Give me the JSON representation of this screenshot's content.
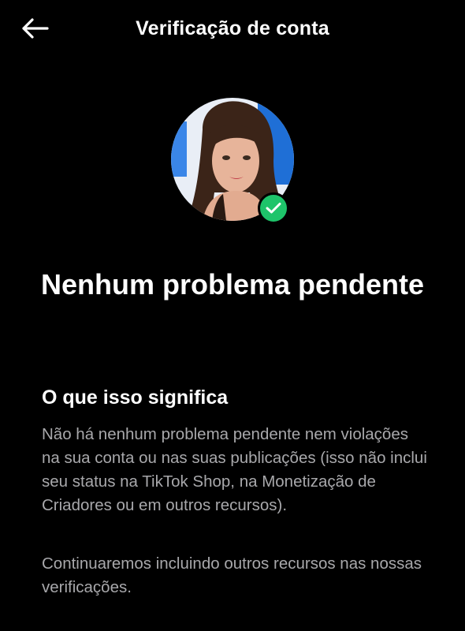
{
  "header": {
    "title": "Verificação de conta",
    "back_icon": "arrow-left-icon"
  },
  "profile": {
    "avatar": "profile-photo",
    "badge_icon": "check-icon",
    "badge_color": "#1ec46a"
  },
  "status": {
    "headline": "Nenhum problema pendente"
  },
  "info": {
    "title": "O que isso significa",
    "paragraph_1": "Não há nenhum problema pendente nem violações na sua conta ou nas suas publicações (isso não inclui seu status na TikTok Shop, na Monetização de Criadores ou em outros recursos).",
    "paragraph_2": "Continuaremos incluindo outros recursos nas nossas verificações."
  },
  "colors": {
    "background": "#000000",
    "text_primary": "#ffffff",
    "text_secondary": "#a8a8ab"
  }
}
